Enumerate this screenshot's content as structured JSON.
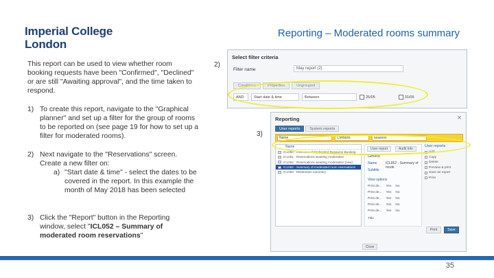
{
  "logo": {
    "line1": "Imperial College",
    "line2": "London"
  },
  "title": "Reporting – Moderated rooms summary",
  "intro": "This report can be used to view whether room booking requests have been \"Confirmed\", \"Declined\" or are still \"Awaiting approval\", and the time taken to respond.",
  "steps": [
    {
      "num": "1)",
      "text": "To create this report, navigate to the \"Graphical planner\" and set up a filter for the group of rooms to be reported on (see page 19 for how to set up a filter for moderated rooms)."
    },
    {
      "num": "2)",
      "text": "Next navigate to the \"Reservations\" screen. Create a new filter on:",
      "sub_num": "a)",
      "sub_text": "\"Start date & time\" - select the dates to be covered in the report. In this example the month of May 2018 has been selected"
    },
    {
      "num": "3)",
      "text_prefix": "Click the \"Report\" button in the Reporting window, select \"",
      "text_bold": "ICL052 – Summary of moderated room reservations",
      "text_suffix": "\""
    }
  ],
  "markers": {
    "m2": "2)",
    "m3": "3)"
  },
  "page_number": "35",
  "screenshot1": {
    "title": "Select filter criteria",
    "label_filter_name": "Filter name",
    "filter_name_value": "May report (2)",
    "tabs": [
      "Conditions",
      "Properties",
      "Ungrouped"
    ],
    "and_label": "AND",
    "field": "Start date & time",
    "operator": "Between",
    "date_from": "25/05",
    "date_to": "31/05"
  },
  "screenshot2": {
    "title": "Reporting",
    "close": "✕",
    "tabs": [
      "User reports",
      "System reports"
    ],
    "filter": {
      "name": "Name",
      "op": "Contains",
      "value": "seasons"
    },
    "list_header": "Name",
    "rows": [
      "ICL050 - Overview of Moderated Resource Booking",
      "ICL051 - Reservations awaiting moderation",
      "ICL052 - Reservations awaiting moderation (new)",
      "ICL052 - Summary of moderated room reservations",
      "ICL053 - Moderation summary"
    ],
    "user_report_btn": "User report",
    "audit_btn": "Audit info",
    "generate_label": "General",
    "links": [
      "Name",
      "Subtitle"
    ],
    "name_value": "ICL052 - Summary of mode",
    "view_options": "View options",
    "opt_rows": [
      "Print de...",
      "Print de...",
      "Print de...",
      "Print de...",
      "Print de...",
      "Title"
    ],
    "yes": "Yes",
    "no": "No",
    "right_header": "User reports",
    "right_items": [
      "Add",
      "Copy",
      "Delete",
      "Preview & print",
      "Save as report",
      "Print"
    ],
    "print_btn": "Print",
    "save_btn": "Save",
    "close_btn": "Close"
  }
}
